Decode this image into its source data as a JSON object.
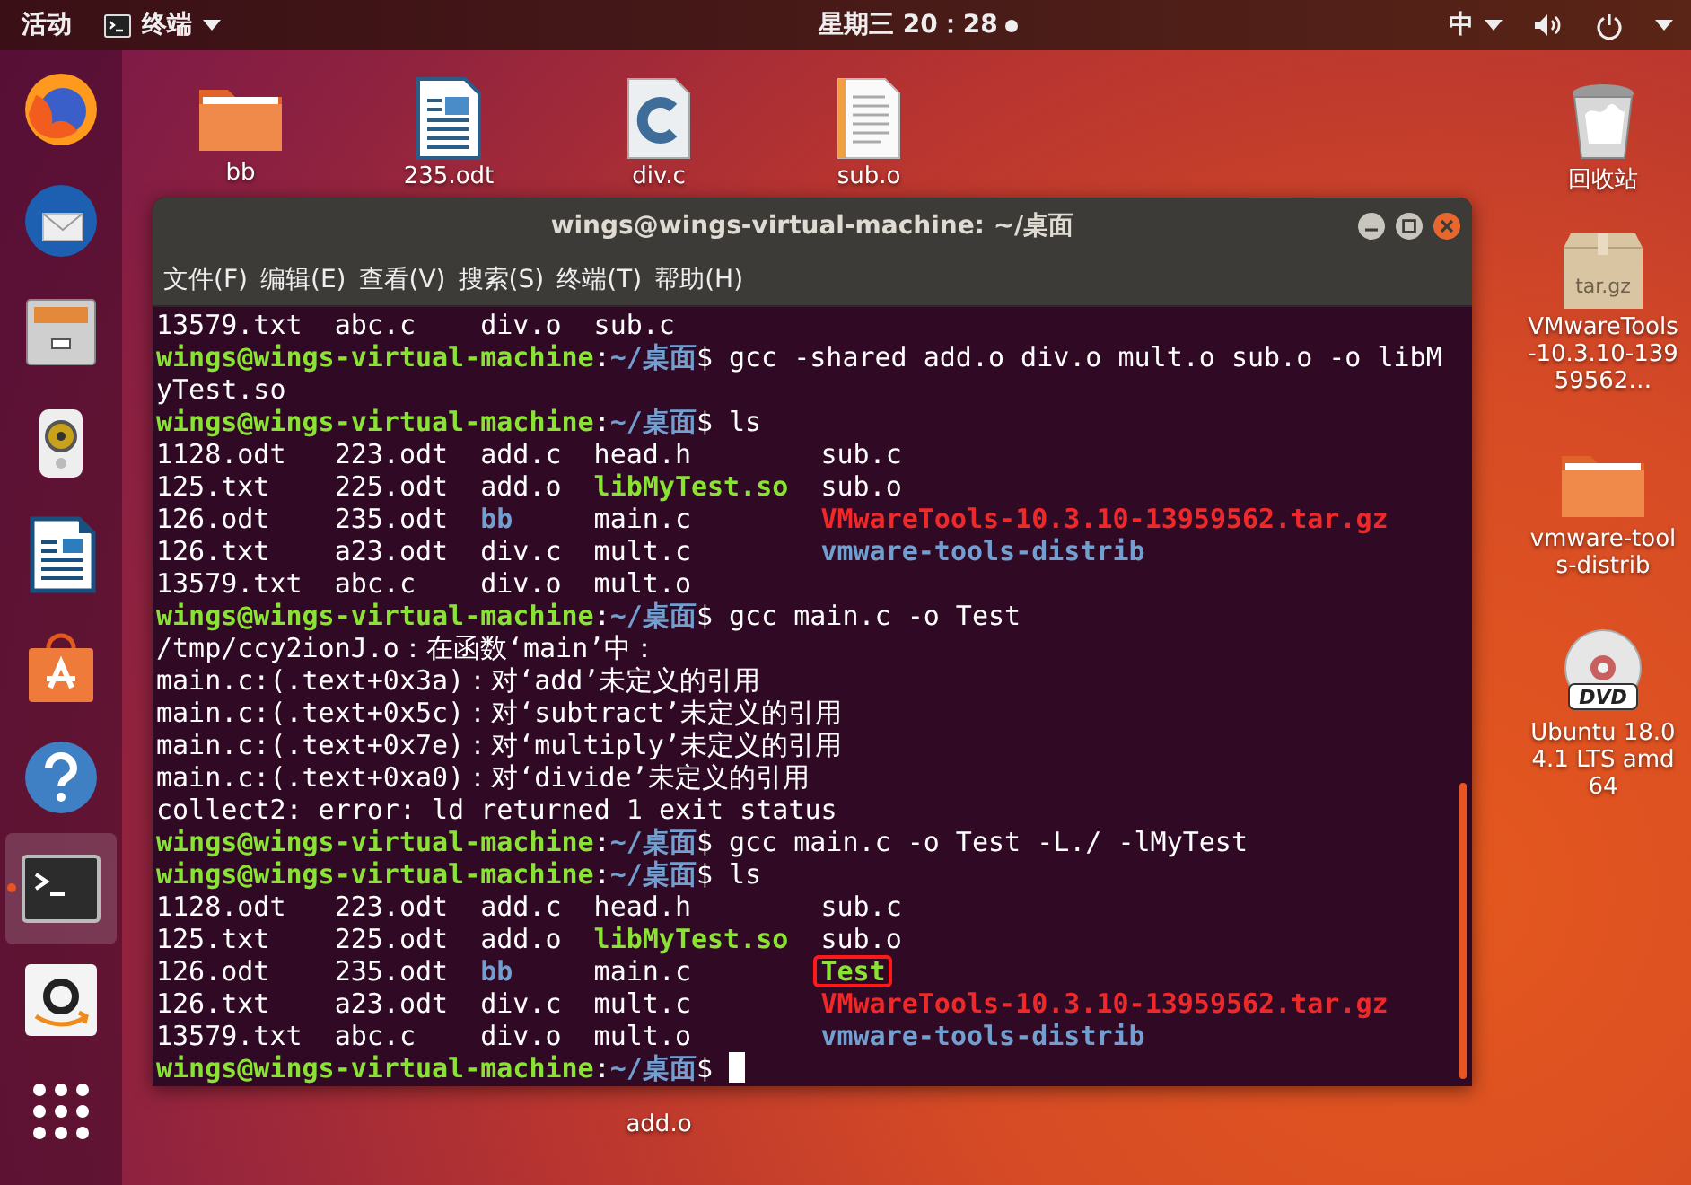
{
  "top_bar": {
    "activities": "活动",
    "app_menu": "终端",
    "clock": "星期三 20：28",
    "notification": true,
    "input_method": "中"
  },
  "dock": [
    {
      "kind": "browser",
      "selected": false,
      "running": false
    },
    {
      "kind": "mail",
      "selected": false,
      "running": false
    },
    {
      "kind": "files",
      "selected": false,
      "running": false
    },
    {
      "kind": "audio",
      "selected": false,
      "running": false
    },
    {
      "kind": "writer",
      "selected": false,
      "running": false
    },
    {
      "kind": "store",
      "selected": false,
      "running": false
    },
    {
      "kind": "help",
      "selected": false,
      "running": false
    },
    {
      "kind": "terminal",
      "selected": true,
      "running": true
    },
    {
      "kind": "amazon",
      "selected": false,
      "running": false
    },
    {
      "kind": "apps",
      "selected": false,
      "running": false
    }
  ],
  "desktop_icons": [
    {
      "label": "bb",
      "kind": "folder"
    },
    {
      "label": "235.odt",
      "kind": "document"
    },
    {
      "label": "div.c",
      "kind": "source"
    },
    {
      "label": "sub.o",
      "kind": "text"
    },
    {
      "label": "回收站",
      "kind": "trash"
    },
    {
      "label": "VMwareTools-10.3.10-13959562…",
      "kind": "archive",
      "badge": "tar.gz"
    },
    {
      "label": "vmware-tools-distrib",
      "kind": "folder"
    },
    {
      "label": "Ubuntu 18.04.1 LTS amd64",
      "kind": "disc",
      "badge": "DVD"
    },
    {
      "label": "add.o"
    }
  ],
  "window": {
    "title": "wings@wings-virtual-machine: ~/桌面",
    "menu": [
      "文件(F)",
      "编辑(E)",
      "查看(V)",
      "搜索(S)",
      "终端(T)",
      "帮助(H)"
    ],
    "lines": [
      {
        "kind": "ls",
        "cells": [
          {
            "text": "13579.txt",
            "kind": "plain",
            "boxed": false
          },
          {
            "text": "abc.c",
            "kind": "plain",
            "boxed": false
          },
          {
            "text": "div.o",
            "kind": "plain",
            "boxed": false
          },
          {
            "text": "sub.c",
            "kind": "plain",
            "boxed": false
          }
        ]
      },
      {
        "kind": "prompt",
        "user": "wings@wings-virtual-machine",
        "separator": ":",
        "path": "~/桌面",
        "symbol": "$",
        "command": "gcc -shared add.o div.o mult.o sub.o -o libM",
        "cursor": false
      },
      {
        "kind": "text",
        "text": "yTest.so"
      },
      {
        "kind": "prompt",
        "user": "wings@wings-virtual-machine",
        "separator": ":",
        "path": "~/桌面",
        "symbol": "$",
        "command": "ls",
        "cursor": false
      },
      {
        "kind": "ls",
        "cells": [
          {
            "text": "1128.odt",
            "kind": "plain",
            "boxed": false
          },
          {
            "text": "223.odt",
            "kind": "plain",
            "boxed": false
          },
          {
            "text": "add.c",
            "kind": "plain",
            "boxed": false
          },
          {
            "text": "head.h",
            "kind": "plain",
            "boxed": false
          },
          {
            "text": "sub.c",
            "kind": "plain",
            "boxed": false
          }
        ]
      },
      {
        "kind": "ls",
        "cells": [
          {
            "text": "125.txt",
            "kind": "plain",
            "boxed": false
          },
          {
            "text": "225.odt",
            "kind": "plain",
            "boxed": false
          },
          {
            "text": "add.o",
            "kind": "plain",
            "boxed": false
          },
          {
            "text": "libMyTest.so",
            "kind": "exec",
            "boxed": false
          },
          {
            "text": "sub.o",
            "kind": "plain",
            "boxed": false
          }
        ]
      },
      {
        "kind": "ls",
        "cells": [
          {
            "text": "126.odt",
            "kind": "plain",
            "boxed": false
          },
          {
            "text": "235.odt",
            "kind": "plain",
            "boxed": false
          },
          {
            "text": "bb",
            "kind": "dir",
            "boxed": false
          },
          {
            "text": "main.c",
            "kind": "plain",
            "boxed": false
          },
          {
            "text": "VMwareTools-10.3.10-13959562.tar.gz",
            "kind": "archive",
            "boxed": false
          }
        ]
      },
      {
        "kind": "ls",
        "cells": [
          {
            "text": "126.txt",
            "kind": "plain",
            "boxed": false
          },
          {
            "text": "a23.odt",
            "kind": "plain",
            "boxed": false
          },
          {
            "text": "div.c",
            "kind": "plain",
            "boxed": false
          },
          {
            "text": "mult.c",
            "kind": "plain",
            "boxed": false
          },
          {
            "text": "vmware-tools-distrib",
            "kind": "dir",
            "boxed": false
          }
        ]
      },
      {
        "kind": "ls",
        "cells": [
          {
            "text": "13579.txt",
            "kind": "plain",
            "boxed": false
          },
          {
            "text": "abc.c",
            "kind": "plain",
            "boxed": false
          },
          {
            "text": "div.o",
            "kind": "plain",
            "boxed": false
          },
          {
            "text": "mult.o",
            "kind": "plain",
            "boxed": false
          }
        ]
      },
      {
        "kind": "prompt",
        "user": "wings@wings-virtual-machine",
        "separator": ":",
        "path": "~/桌面",
        "symbol": "$",
        "command": "gcc main.c -o Test",
        "cursor": false
      },
      {
        "kind": "text",
        "text": "/tmp/ccy2ionJ.o：在函数‘main’中："
      },
      {
        "kind": "text",
        "text": "main.c:(.text+0x3a)：对‘add’未定义的引用"
      },
      {
        "kind": "text",
        "text": "main.c:(.text+0x5c)：对‘subtract’未定义的引用"
      },
      {
        "kind": "text",
        "text": "main.c:(.text+0x7e)：对‘multiply’未定义的引用"
      },
      {
        "kind": "text",
        "text": "main.c:(.text+0xa0)：对‘divide’未定义的引用"
      },
      {
        "kind": "text",
        "text": "collect2: error: ld returned 1 exit status"
      },
      {
        "kind": "prompt",
        "user": "wings@wings-virtual-machine",
        "separator": ":",
        "path": "~/桌面",
        "symbol": "$",
        "command": "gcc main.c -o Test -L./ -lMyTest",
        "cursor": false
      },
      {
        "kind": "prompt",
        "user": "wings@wings-virtual-machine",
        "separator": ":",
        "path": "~/桌面",
        "symbol": "$",
        "command": "ls",
        "cursor": false
      },
      {
        "kind": "ls",
        "cells": [
          {
            "text": "1128.odt",
            "kind": "plain",
            "boxed": false
          },
          {
            "text": "223.odt",
            "kind": "plain",
            "boxed": false
          },
          {
            "text": "add.c",
            "kind": "plain",
            "boxed": false
          },
          {
            "text": "head.h",
            "kind": "plain",
            "boxed": false
          },
          {
            "text": "sub.c",
            "kind": "plain",
            "boxed": false
          }
        ]
      },
      {
        "kind": "ls",
        "cells": [
          {
            "text": "125.txt",
            "kind": "plain",
            "boxed": false
          },
          {
            "text": "225.odt",
            "kind": "plain",
            "boxed": false
          },
          {
            "text": "add.o",
            "kind": "plain",
            "boxed": false
          },
          {
            "text": "libMyTest.so",
            "kind": "exec",
            "boxed": false
          },
          {
            "text": "sub.o",
            "kind": "plain",
            "boxed": false
          }
        ]
      },
      {
        "kind": "ls",
        "cells": [
          {
            "text": "126.odt",
            "kind": "plain",
            "boxed": false
          },
          {
            "text": "235.odt",
            "kind": "plain",
            "boxed": false
          },
          {
            "text": "bb",
            "kind": "dir",
            "boxed": false
          },
          {
            "text": "main.c",
            "kind": "plain",
            "boxed": false
          },
          {
            "text": "Test",
            "kind": "exec",
            "boxed": true
          }
        ]
      },
      {
        "kind": "ls",
        "cells": [
          {
            "text": "126.txt",
            "kind": "plain",
            "boxed": false
          },
          {
            "text": "a23.odt",
            "kind": "plain",
            "boxed": false
          },
          {
            "text": "div.c",
            "kind": "plain",
            "boxed": false
          },
          {
            "text": "mult.c",
            "kind": "plain",
            "boxed": false
          },
          {
            "text": "VMwareTools-10.3.10-13959562.tar.gz",
            "kind": "archive",
            "boxed": false
          }
        ]
      },
      {
        "kind": "ls",
        "cells": [
          {
            "text": "13579.txt",
            "kind": "plain",
            "boxed": false
          },
          {
            "text": "abc.c",
            "kind": "plain",
            "boxed": false
          },
          {
            "text": "div.o",
            "kind": "plain",
            "boxed": false
          },
          {
            "text": "mult.o",
            "kind": "plain",
            "boxed": false
          },
          {
            "text": "vmware-tools-distrib",
            "kind": "dir",
            "boxed": false
          }
        ]
      },
      {
        "kind": "prompt",
        "user": "wings@wings-virtual-machine",
        "separator": ":",
        "path": "~/桌面",
        "symbol": "$",
        "cursor": true
      }
    ]
  }
}
